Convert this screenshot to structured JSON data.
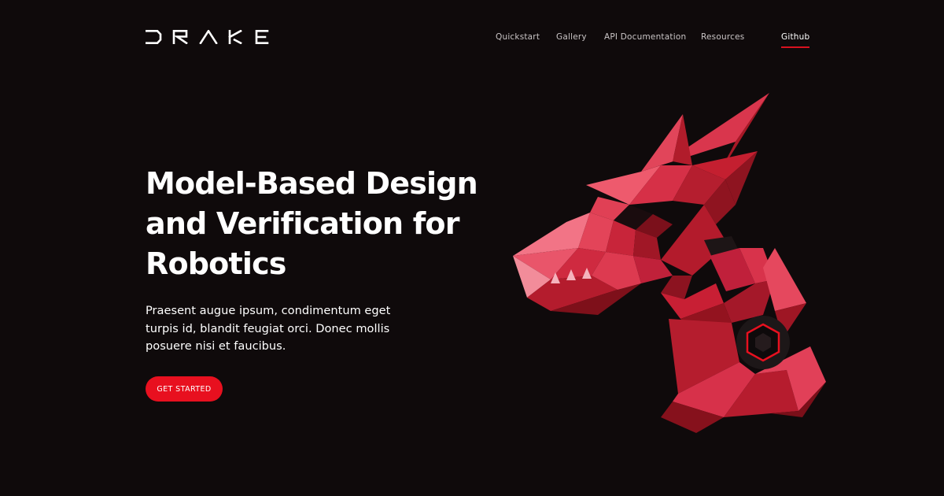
{
  "brand": {
    "logo_text": "DRAKE"
  },
  "nav": {
    "items": [
      {
        "label": "Quickstart"
      },
      {
        "label": "Gallery"
      },
      {
        "label": "API Documentation"
      },
      {
        "label": "Resources"
      },
      {
        "label": "Github",
        "active": true
      }
    ]
  },
  "hero": {
    "title": "Model-Based Design and Verification for Robotics",
    "description": "Praesent augue ipsum, condimentum eget turpis id, blandit feugiat orci. Donec mollis posuere nisi et faucibus.",
    "cta_label": "GET STARTED"
  },
  "illustration": {
    "icon": "low-poly-dragon-robot-icon"
  },
  "colors": {
    "background": "#0f0a0b",
    "accent": "#e8101f",
    "text": "#ffffff",
    "nav_text": "#c9c4c5"
  }
}
